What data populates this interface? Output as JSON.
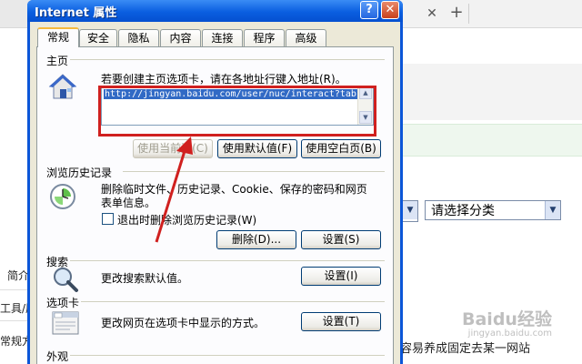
{
  "browser": {
    "category_select": "请选择分类",
    "left_items": [
      "简介",
      "工具/原",
      "常规方"
    ],
    "bottom_text": "容易养成固定去某一网站",
    "watermark": "Baidu经验",
    "watermark_sub": "jingyan.baidu.com"
  },
  "dialog": {
    "title": "Internet 属性",
    "help": "?",
    "close": "✕",
    "tabs": [
      "常规",
      "安全",
      "隐私",
      "内容",
      "连接",
      "程序",
      "高级"
    ],
    "active_tab": "常规",
    "homepage": {
      "title": "主页",
      "instruction": "若要创建主页选项卡，请在各地址行键入地址(R)。",
      "url": "http://jingyan.baidu.com/user/nuc/interact?tab",
      "btn_current": "使用当前页(C)",
      "btn_default": "使用默认值(F)",
      "btn_blank": "使用空白页(B)"
    },
    "history": {
      "title": "浏览历史记录",
      "desc_line1": "删除临时文件、历史记录、Cookie、保存的密码和网页",
      "desc_line2": "表单信息。",
      "checkbox_label": "退出时删除浏览历史记录(W)",
      "checkbox_checked": false,
      "btn_delete": "删除(D)...",
      "btn_settings": "设置(S)"
    },
    "search": {
      "title": "搜索",
      "desc": "更改搜索默认值。",
      "btn_settings": "设置(I)"
    },
    "tabs_section": {
      "title": "选项卡",
      "desc": "更改网页在选项卡中显示的方式。",
      "btn_settings": "设置(T)"
    },
    "appearance": {
      "title": "外观"
    }
  },
  "colors": {
    "titlebar": "#0a5ee0",
    "highlight": "#d0201f",
    "selection": "#316ac5"
  }
}
